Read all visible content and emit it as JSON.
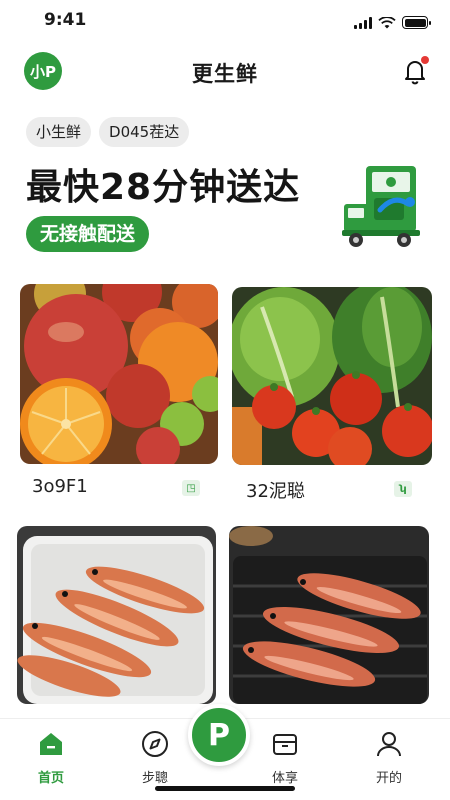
{
  "status_bar": {
    "time": "9:41"
  },
  "header": {
    "logo_text": "小P",
    "title": "更生鲜"
  },
  "tags": [
    "小生鲜",
    "D045茬达"
  ],
  "banner": {
    "headline": "最快28分钟送达",
    "cta_label": "无接触配送"
  },
  "products": [
    {
      "label": "3o9F1",
      "image": "fruits-photo"
    },
    {
      "label": "32泥聪",
      "image": "vegetables-photo"
    },
    {
      "label": "",
      "image": "raw-fish-tray-photo"
    },
    {
      "label": "",
      "image": "grilled-fish-photo"
    }
  ],
  "fab": {
    "label": "P"
  },
  "bottom_nav": [
    {
      "label": "首页",
      "icon": "home-icon",
      "active": true
    },
    {
      "label": "步聰",
      "icon": "compass-icon",
      "active": false
    },
    {
      "label": "体享",
      "icon": "box-icon",
      "active": false
    },
    {
      "label": "开的",
      "icon": "user-icon",
      "active": false
    }
  ],
  "colors": {
    "accent": "#2f9b3f",
    "badge": "#e53935"
  }
}
